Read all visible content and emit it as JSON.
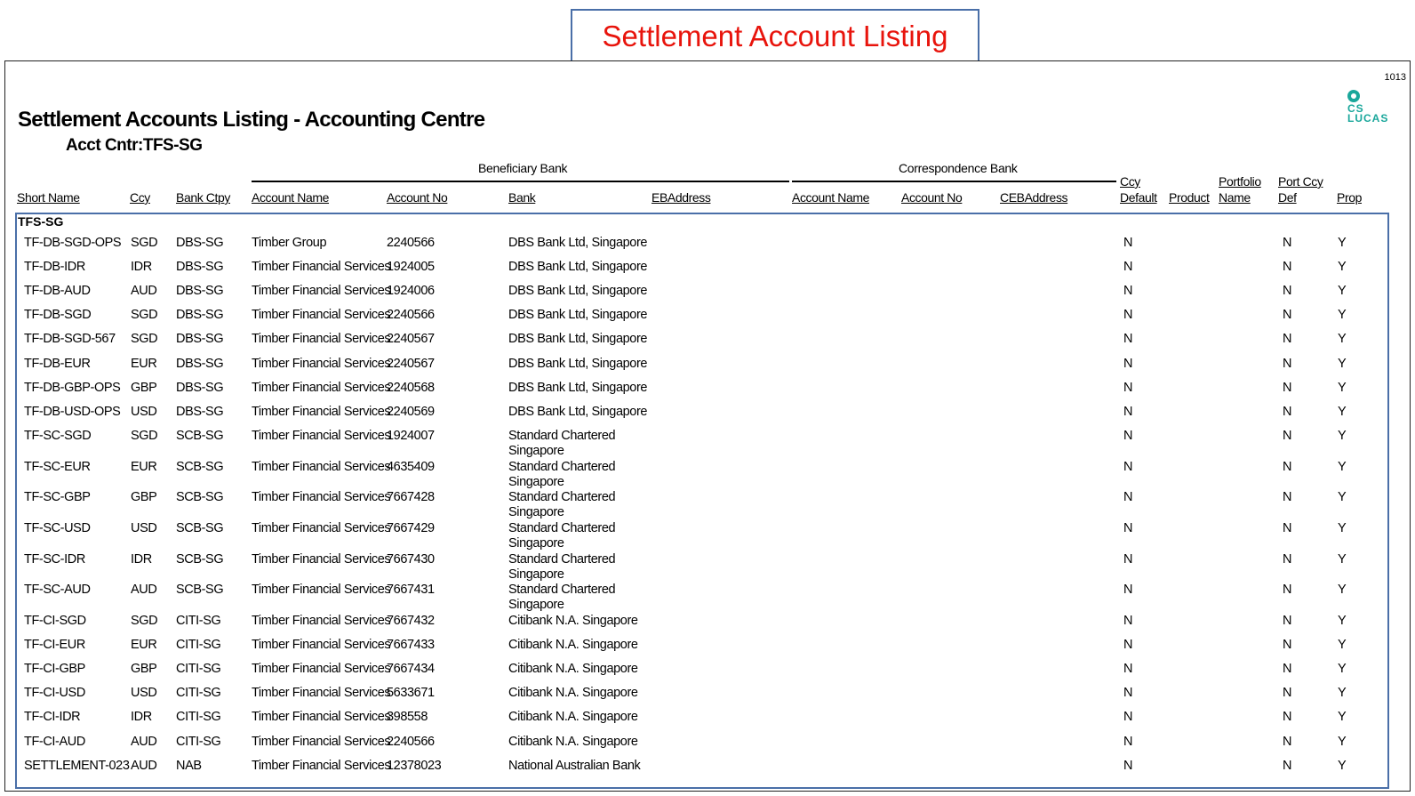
{
  "callout": {
    "title": "Settlement Account Listing"
  },
  "report": {
    "page_number": "1013",
    "logo": {
      "icon": "cs-lucas-logo",
      "text": "CS\nLUCAS"
    },
    "title": "Settlement Accounts Listing - Accounting Centre",
    "subtitle": "Acct Cntr:TFS-SG",
    "groups": {
      "beneficiary": "Beneficiary Bank",
      "correspondence": "Correspondence Bank"
    },
    "columns": {
      "short_name": "Short Name",
      "ccy": "Ccy",
      "bank_ctpy": "Bank Ctpy",
      "account_name": "Account Name",
      "account_no": "Account No",
      "bank": "Bank",
      "eb_address": "EBAddress",
      "corr_account_name": "Account Name",
      "corr_account_no": "Account No",
      "ceb_address": "CEBAddress",
      "ccy_default_1": "Ccy",
      "ccy_default_2": "Default",
      "product": "Product",
      "portfolio_name_1": "Portfolio",
      "portfolio_name_2": "Name",
      "port_ccy_def_1": "Port Ccy",
      "port_ccy_def_2": "Def",
      "prop": "Prop"
    },
    "group_name": "TFS-SG",
    "rows": [
      {
        "short_name": "TF-DB-SGD-OPS",
        "ccy": "SGD",
        "bank_ctpy": "DBS-SG",
        "account_name": "Timber Group",
        "account_no": "2240566",
        "bank": "DBS Bank Ltd, Singapore",
        "ccy_default": "N",
        "port_ccy_def": "N",
        "prop": "Y"
      },
      {
        "short_name": "TF-DB-IDR",
        "ccy": "IDR",
        "bank_ctpy": "DBS-SG",
        "account_name": "Timber Financial Services",
        "account_no": "1924005",
        "bank": "DBS Bank Ltd, Singapore",
        "ccy_default": "N",
        "port_ccy_def": "N",
        "prop": "Y"
      },
      {
        "short_name": "TF-DB-AUD",
        "ccy": "AUD",
        "bank_ctpy": "DBS-SG",
        "account_name": "Timber Financial Services",
        "account_no": "1924006",
        "bank": "DBS Bank Ltd, Singapore",
        "ccy_default": "N",
        "port_ccy_def": "N",
        "prop": "Y"
      },
      {
        "short_name": "TF-DB-SGD",
        "ccy": "SGD",
        "bank_ctpy": "DBS-SG",
        "account_name": "Timber Financial Services",
        "account_no": "2240566",
        "bank": "DBS Bank Ltd, Singapore",
        "ccy_default": "N",
        "port_ccy_def": "N",
        "prop": "Y"
      },
      {
        "short_name": "TF-DB-SGD-567",
        "ccy": "SGD",
        "bank_ctpy": "DBS-SG",
        "account_name": "Timber Financial Services",
        "account_no": "2240567",
        "bank": "DBS Bank Ltd, Singapore",
        "ccy_default": "N",
        "port_ccy_def": "N",
        "prop": "Y"
      },
      {
        "short_name": "TF-DB-EUR",
        "ccy": "EUR",
        "bank_ctpy": "DBS-SG",
        "account_name": "Timber Financial Services",
        "account_no": "2240567",
        "bank": "DBS Bank Ltd, Singapore",
        "ccy_default": "N",
        "port_ccy_def": "N",
        "prop": "Y"
      },
      {
        "short_name": "TF-DB-GBP-OPS",
        "ccy": "GBP",
        "bank_ctpy": "DBS-SG",
        "account_name": "Timber Financial Services",
        "account_no": "2240568",
        "bank": "DBS Bank Ltd, Singapore",
        "ccy_default": "N",
        "port_ccy_def": "N",
        "prop": "Y"
      },
      {
        "short_name": "TF-DB-USD-OPS",
        "ccy": "USD",
        "bank_ctpy": "DBS-SG",
        "account_name": "Timber Financial Services",
        "account_no": "2240569",
        "bank": "DBS Bank Ltd, Singapore",
        "ccy_default": "N",
        "port_ccy_def": "N",
        "prop": "Y"
      },
      {
        "short_name": "TF-SC-SGD",
        "ccy": "SGD",
        "bank_ctpy": "SCB-SG",
        "account_name": "Timber Financial Services",
        "account_no": "1924007",
        "bank": "Standard Chartered Singapore",
        "ccy_default": "N",
        "port_ccy_def": "N",
        "prop": "Y"
      },
      {
        "short_name": "TF-SC-EUR",
        "ccy": "EUR",
        "bank_ctpy": "SCB-SG",
        "account_name": "Timber Financial Services",
        "account_no": "4635409",
        "bank": "Standard Chartered Singapore",
        "ccy_default": "N",
        "port_ccy_def": "N",
        "prop": "Y"
      },
      {
        "short_name": "TF-SC-GBP",
        "ccy": "GBP",
        "bank_ctpy": "SCB-SG",
        "account_name": "Timber Financial Services",
        "account_no": "7667428",
        "bank": "Standard Chartered Singapore",
        "ccy_default": "N",
        "port_ccy_def": "N",
        "prop": "Y"
      },
      {
        "short_name": "TF-SC-USD",
        "ccy": "USD",
        "bank_ctpy": "SCB-SG",
        "account_name": "Timber Financial Services",
        "account_no": "7667429",
        "bank": "Standard Chartered Singapore",
        "ccy_default": "N",
        "port_ccy_def": "N",
        "prop": "Y"
      },
      {
        "short_name": "TF-SC-IDR",
        "ccy": "IDR",
        "bank_ctpy": "SCB-SG",
        "account_name": "Timber Financial Services",
        "account_no": "7667430",
        "bank": "Standard Chartered Singapore",
        "ccy_default": "N",
        "port_ccy_def": "N",
        "prop": "Y"
      },
      {
        "short_name": "TF-SC-AUD",
        "ccy": "AUD",
        "bank_ctpy": "SCB-SG",
        "account_name": "Timber Financial Services",
        "account_no": "7667431",
        "bank": "Standard Chartered Singapore",
        "ccy_default": "N",
        "port_ccy_def": "N",
        "prop": "Y"
      },
      {
        "short_name": "TF-CI-SGD",
        "ccy": "SGD",
        "bank_ctpy": "CITI-SG",
        "account_name": "Timber Financial Services",
        "account_no": "7667432",
        "bank": "Citibank N.A. Singapore",
        "ccy_default": "N",
        "port_ccy_def": "N",
        "prop": "Y"
      },
      {
        "short_name": "TF-CI-EUR",
        "ccy": "EUR",
        "bank_ctpy": "CITI-SG",
        "account_name": "Timber Financial Services",
        "account_no": "7667433",
        "bank": "Citibank N.A. Singapore",
        "ccy_default": "N",
        "port_ccy_def": "N",
        "prop": "Y"
      },
      {
        "short_name": "TF-CI-GBP",
        "ccy": "GBP",
        "bank_ctpy": "CITI-SG",
        "account_name": "Timber Financial Services",
        "account_no": "7667434",
        "bank": "Citibank N.A. Singapore",
        "ccy_default": "N",
        "port_ccy_def": "N",
        "prop": "Y"
      },
      {
        "short_name": "TF-CI-USD",
        "ccy": "USD",
        "bank_ctpy": "CITI-SG",
        "account_name": "Timber Financial Services",
        "account_no": "5633671",
        "bank": "Citibank N.A. Singapore",
        "ccy_default": "N",
        "port_ccy_def": "N",
        "prop": "Y"
      },
      {
        "short_name": "TF-CI-IDR",
        "ccy": "IDR",
        "bank_ctpy": "CITI-SG",
        "account_name": "Timber Financial Services",
        "account_no": "398558",
        "bank": "Citibank N.A. Singapore",
        "ccy_default": "N",
        "port_ccy_def": "N",
        "prop": "Y"
      },
      {
        "short_name": "TF-CI-AUD",
        "ccy": "AUD",
        "bank_ctpy": "CITI-SG",
        "account_name": "Timber Financial Services",
        "account_no": "2240566",
        "bank": "Citibank N.A. Singapore",
        "ccy_default": "N",
        "port_ccy_def": "N",
        "prop": "Y"
      },
      {
        "short_name": "SETTLEMENT-023",
        "ccy": "AUD",
        "bank_ctpy": "NAB",
        "account_name": "Timber Financial Services",
        "account_no": "12378023",
        "bank": "National Australian Bank",
        "ccy_default": "N",
        "port_ccy_def": "N",
        "prop": "Y"
      }
    ]
  },
  "colors": {
    "callout_text": "#e8140c",
    "callout_border": "#4a6fa8",
    "logo": "#1aa79b"
  }
}
